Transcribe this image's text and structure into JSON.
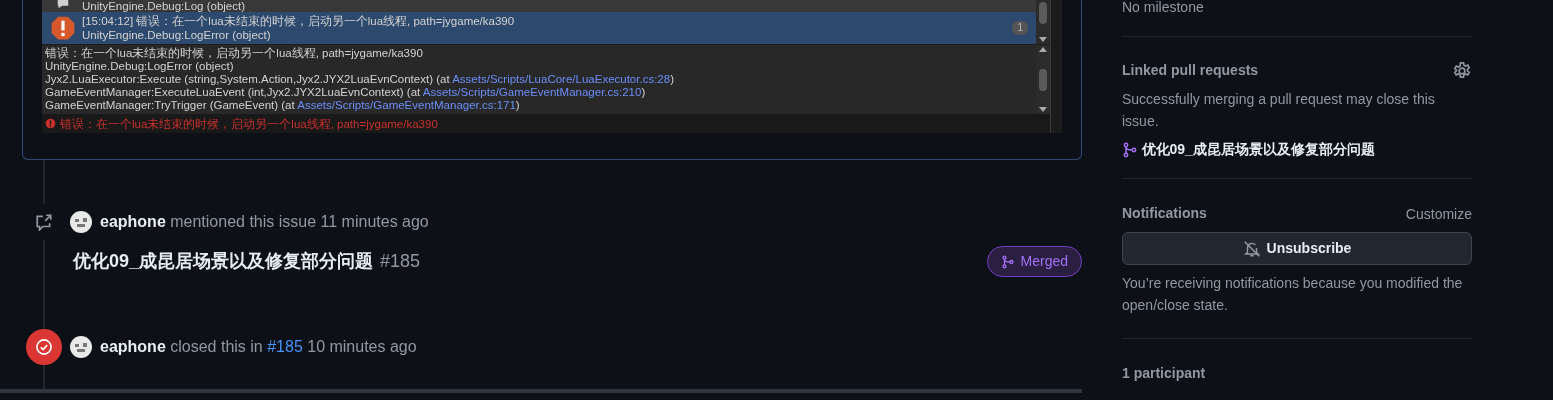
{
  "console_log": {
    "entries": [
      {
        "kind": "log",
        "selected": false,
        "lines": [
          "UnityEngine.Debug:Log (object)"
        ]
      },
      {
        "kind": "error",
        "selected": true,
        "lines": [
          "[15:04:12] 错误：在一个lua未结束的时候，启动另一个lua线程, path=jygame/ka390",
          "UnityEngine.Debug:LogError (object)"
        ],
        "count": "1"
      }
    ],
    "detail": [
      {
        "text": "错误：在一个lua未结束的时候，启动另一个lua线程, path=jygame/ka390"
      },
      {
        "text": "UnityEngine.Debug:LogError (object)"
      },
      {
        "text": "Jyx2.LuaExecutor:Execute (string,System.Action,Jyx2.JYX2LuaEvnContext) (at ",
        "link": "Assets/Scripts/LuaCore/LuaExecutor.cs:28",
        "after": ")"
      },
      {
        "text": "GameEventManager:ExecuteLuaEvent (int,Jyx2.JYX2LuaEvnContext) (at ",
        "link": "Assets/Scripts/GameEventManager.cs:210",
        "after": ")"
      },
      {
        "text": "GameEventManager:TryTrigger (GameEvent) (at ",
        "link": "Assets/Scripts/GameEventManager.cs:171",
        "after": ")"
      }
    ],
    "status": "错误：在一个lua未结束的时候，启动另一个lua线程, path=jygame/ka390"
  },
  "timeline": [
    {
      "kind": "mentioned",
      "user": "eaphone",
      "action": "mentioned this issue",
      "time": "11 minutes ago",
      "pr_title": "优化09_成昆居场景以及修复部分问题",
      "pr_number": "#185",
      "pr_state": "Merged"
    },
    {
      "kind": "closed",
      "user": "eaphone",
      "action": "closed this in",
      "link": "#185",
      "time": "10 minutes ago"
    }
  ],
  "sidebar": {
    "milestone": "No milestone",
    "linked_pull_requests": {
      "heading": "Linked pull requests",
      "description": "Successfully merging a pull request may close this issue.",
      "items": [
        "优化09_成昆居场景以及修复部分问题"
      ]
    },
    "notifications": {
      "heading": "Notifications",
      "customize": "Customize",
      "button": "Unsubscribe",
      "note": "You’re receiving notifications because you modified the open/close state."
    },
    "participants": "1 participant"
  }
}
